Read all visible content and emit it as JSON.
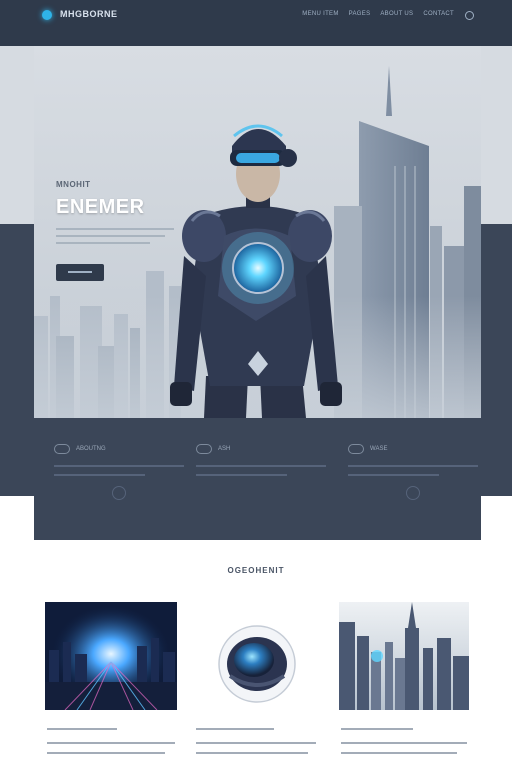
{
  "header": {
    "brand": "MHGBORNE",
    "nav": [
      "MENU ITEM",
      "PAGES",
      "ABOUT US",
      "CONTACT"
    ]
  },
  "hero": {
    "eyebrow": "MNOHIT",
    "title": "ENEMER"
  },
  "features": [
    {
      "label": "ABOUTNG"
    },
    {
      "label": "ASH"
    },
    {
      "label": "WASE"
    }
  ],
  "section": {
    "title": "OGEOHENIT"
  },
  "colors": {
    "header_bg": "#2f3a4b",
    "frame_bg": "#3b4658",
    "accent": "#2fb4e8"
  }
}
